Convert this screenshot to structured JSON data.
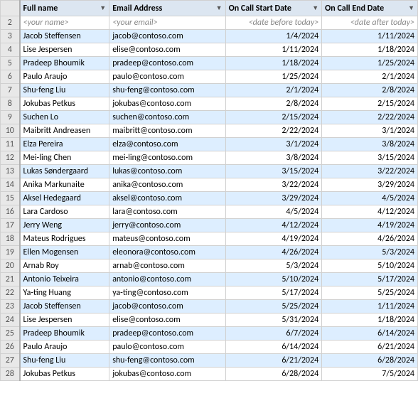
{
  "columns": [
    {
      "id": "row-num",
      "label": ""
    },
    {
      "id": "A",
      "label": "Full name"
    },
    {
      "id": "B",
      "label": "Email Address"
    },
    {
      "id": "C",
      "label": "On Call Start Date"
    },
    {
      "id": "D",
      "label": "On Call End Date"
    }
  ],
  "template_row": {
    "A": "<your name>",
    "B": "<your email>",
    "C": "<date before today>",
    "D": "<date after today>"
  },
  "rows": [
    {
      "num": 3,
      "A": "Jacob Steffensen",
      "B": "jacob@contoso.com",
      "C": "1/4/2024",
      "D": "1/11/2024"
    },
    {
      "num": 4,
      "A": "Lise Jespersen",
      "B": "elise@contoso.com",
      "C": "1/11/2024",
      "D": "1/18/2024"
    },
    {
      "num": 5,
      "A": "Pradeep Bhoumik",
      "B": "pradeep@contoso.com",
      "C": "1/18/2024",
      "D": "1/25/2024"
    },
    {
      "num": 6,
      "A": "Paulo Araujo",
      "B": "paulo@contoso.com",
      "C": "1/25/2024",
      "D": "2/1/2024"
    },
    {
      "num": 7,
      "A": "Shu-feng Liu",
      "B": "shu-feng@contoso.com",
      "C": "2/1/2024",
      "D": "2/8/2024"
    },
    {
      "num": 8,
      "A": "Jokubas Petkus",
      "B": "jokubas@contoso.com",
      "C": "2/8/2024",
      "D": "2/15/2024"
    },
    {
      "num": 9,
      "A": "Suchen Lo",
      "B": "suchen@contoso.com",
      "C": "2/15/2024",
      "D": "2/22/2024"
    },
    {
      "num": 10,
      "A": "Maibritt Andreasen",
      "B": "maibritt@contoso.com",
      "C": "2/22/2024",
      "D": "3/1/2024"
    },
    {
      "num": 11,
      "A": "Elza Pereira",
      "B": "elza@contoso.com",
      "C": "3/1/2024",
      "D": "3/8/2024"
    },
    {
      "num": 12,
      "A": "Mei-ling Chen",
      "B": "mei-ling@contoso.com",
      "C": "3/8/2024",
      "D": "3/15/2024"
    },
    {
      "num": 13,
      "A": "Lukas Søndergaard",
      "B": "lukas@contoso.com",
      "C": "3/15/2024",
      "D": "3/22/2024"
    },
    {
      "num": 14,
      "A": "Anika Markunaite",
      "B": "anika@contoso.com",
      "C": "3/22/2024",
      "D": "3/29/2024"
    },
    {
      "num": 15,
      "A": "Aksel Hedegaard",
      "B": "aksel@contoso.com",
      "C": "3/29/2024",
      "D": "4/5/2024"
    },
    {
      "num": 16,
      "A": "Lara Cardoso",
      "B": "lara@contoso.com",
      "C": "4/5/2024",
      "D": "4/12/2024"
    },
    {
      "num": 17,
      "A": "Jerry Weng",
      "B": "jerry@contoso.com",
      "C": "4/12/2024",
      "D": "4/19/2024"
    },
    {
      "num": 18,
      "A": "Mateus Rodrigues",
      "B": "mateus@contoso.com",
      "C": "4/19/2024",
      "D": "4/26/2024"
    },
    {
      "num": 19,
      "A": "Ellen Mogensen",
      "B": "eleonora@contoso.com",
      "C": "4/26/2024",
      "D": "5/3/2024"
    },
    {
      "num": 20,
      "A": "Arnab Roy",
      "B": "arnab@contoso.com",
      "C": "5/3/2024",
      "D": "5/10/2024"
    },
    {
      "num": 21,
      "A": "Antonio Teixeira",
      "B": "antonio@contoso.com",
      "C": "5/10/2024",
      "D": "5/17/2024"
    },
    {
      "num": 22,
      "A": "Ya-ting Huang",
      "B": "ya-ting@contoso.com",
      "C": "5/17/2024",
      "D": "5/25/2024"
    },
    {
      "num": 23,
      "A": "Jacob Steffensen",
      "B": "jacob@contoso.com",
      "C": "5/25/2024",
      "D": "1/11/2024"
    },
    {
      "num": 24,
      "A": "Lise Jespersen",
      "B": "elise@contoso.com",
      "C": "5/31/2024",
      "D": "1/18/2024"
    },
    {
      "num": 25,
      "A": "Pradeep Bhoumik",
      "B": "pradeep@contoso.com",
      "C": "6/7/2024",
      "D": "6/14/2024"
    },
    {
      "num": 26,
      "A": "Paulo Araujo",
      "B": "paulo@contoso.com",
      "C": "6/14/2024",
      "D": "6/21/2024"
    },
    {
      "num": 27,
      "A": "Shu-feng Liu",
      "B": "shu-feng@contoso.com",
      "C": "6/21/2024",
      "D": "6/28/2024"
    },
    {
      "num": 28,
      "A": "Jokubas Petkus",
      "B": "jokubas@contoso.com",
      "C": "6/28/2024",
      "D": "7/5/2024"
    }
  ]
}
